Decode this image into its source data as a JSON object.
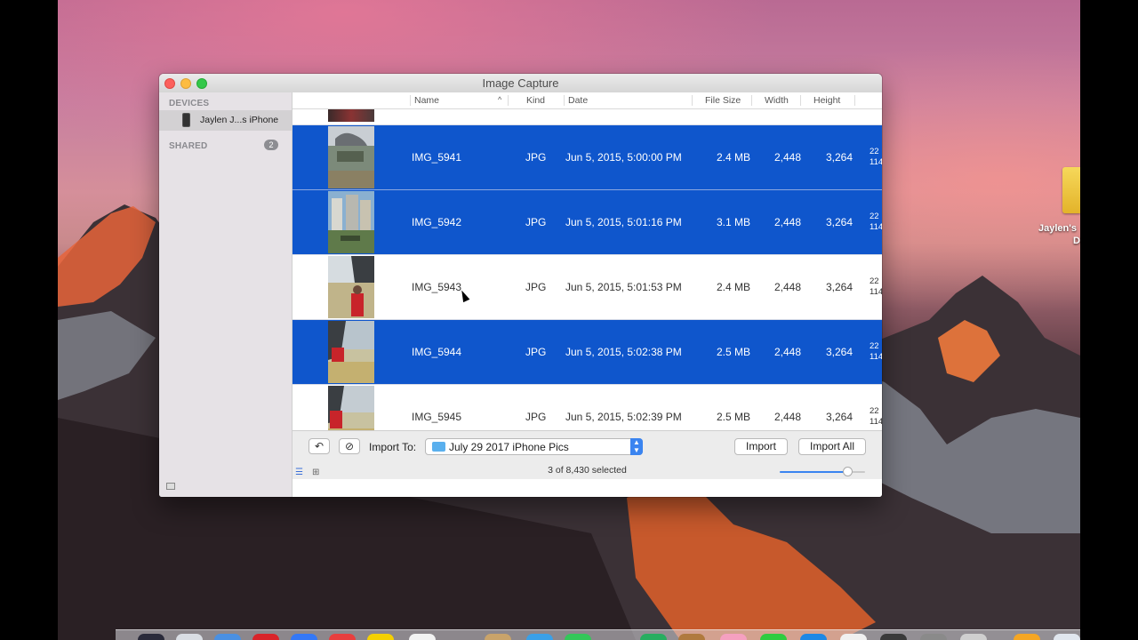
{
  "window": {
    "title": "Image Capture"
  },
  "sidebar": {
    "devices_header": "DEVICES",
    "device_label": "Jaylen J...s iPhone",
    "shared_header": "SHARED",
    "shared_count": "2"
  },
  "columns": {
    "name": "Name",
    "kind": "Kind",
    "date": "Date",
    "file_size": "File Size",
    "width": "Width",
    "height": "Height"
  },
  "rows": [
    {
      "name": "IMG_5941",
      "kind": "JPG",
      "date": "Jun 5, 2015, 5:00:00 PM",
      "size": "2.4 MB",
      "width": "2,448",
      "height": "3,264",
      "extra1": "22",
      "extra2": "114",
      "selected": true
    },
    {
      "name": "IMG_5942",
      "kind": "JPG",
      "date": "Jun 5, 2015, 5:01:16 PM",
      "size": "3.1 MB",
      "width": "2,448",
      "height": "3,264",
      "extra1": "22",
      "extra2": "114",
      "selected": true
    },
    {
      "name": "IMG_5943",
      "kind": "JPG",
      "date": "Jun 5, 2015, 5:01:53 PM",
      "size": "2.4 MB",
      "width": "2,448",
      "height": "3,264",
      "extra1": "22",
      "extra2": "114",
      "selected": false
    },
    {
      "name": "IMG_5944",
      "kind": "JPG",
      "date": "Jun 5, 2015, 5:02:38 PM",
      "size": "2.5 MB",
      "width": "2,448",
      "height": "3,264",
      "extra1": "22",
      "extra2": "114",
      "selected": true
    },
    {
      "name": "IMG_5945",
      "kind": "JPG",
      "date": "Jun 5, 2015, 5:02:39 PM",
      "size": "2.5 MB",
      "width": "2,448",
      "height": "3,264",
      "extra1": "22",
      "extra2": "114",
      "selected": false
    }
  ],
  "bottom": {
    "import_to_label": "Import To:",
    "destination": "July 29 2017 iPhone Pics",
    "import_button": "Import",
    "import_all_button": "Import All",
    "status": "3 of 8,430 selected",
    "thumbnail_size": 0.8
  },
  "desktop": {
    "drive_label_line1": "Jaylen's",
    "drive_label_line2": "D"
  },
  "colors": {
    "selection": "#0f56cc",
    "accent": "#3a84f0"
  }
}
